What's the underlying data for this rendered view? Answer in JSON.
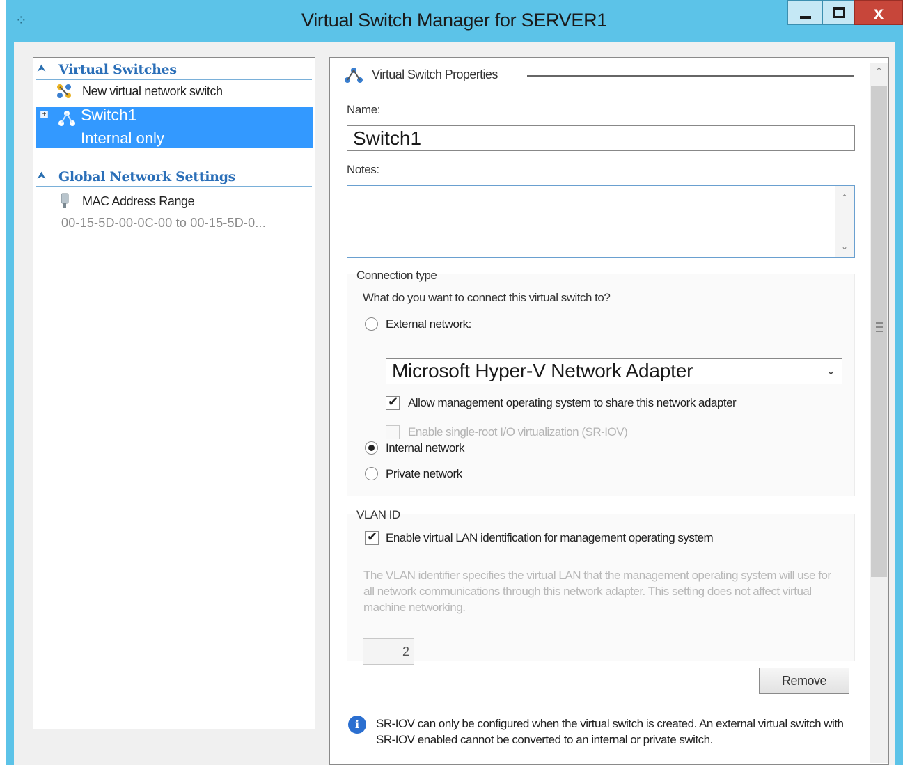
{
  "window": {
    "title": "Virtual Switch Manager for SERVER1",
    "close_symbol": "x",
    "accent_color": "#5cc3e8"
  },
  "left_panel": {
    "virtual_switches_header": "Virtual Switches",
    "new_switch_label": "New virtual network switch",
    "selected_switch": {
      "name": "Switch1",
      "type": "Internal only"
    },
    "global_settings_header": "Global Network Settings",
    "mac_label": "MAC Address Range",
    "mac_value": "00-15-5D-00-0C-00 to 00-15-5D-0..."
  },
  "properties": {
    "header": "Virtual Switch Properties",
    "name_label": "Name:",
    "name_value": "Switch1",
    "notes_label": "Notes:",
    "notes_value": "",
    "connection": {
      "title": "Connection type",
      "question": "What do you want to connect this virtual switch to?",
      "external_label": "External network:",
      "adapter_value": "Microsoft Hyper-V Network Adapter",
      "allow_mgmt_label": "Allow management operating system to share this network adapter",
      "allow_mgmt_checked": true,
      "sriov_label": "Enable single-root I/O virtualization (SR-IOV)",
      "sriov_checked": false,
      "internal_label": "Internal network",
      "private_label": "Private network",
      "selected": "internal"
    },
    "vlan": {
      "title": "VLAN ID",
      "enable_label": "Enable virtual LAN identification for management operating system",
      "enable_checked": true,
      "description": "The VLAN identifier specifies the virtual LAN that the management operating system will use for all network communications through this network adapter. This setting does not affect virtual machine networking.",
      "value": "2"
    },
    "remove_label": "Remove",
    "info_icon": "i",
    "info_text": "SR-IOV can only be configured when the virtual switch is created. An external virtual switch with SR-IOV enabled cannot be converted to an internal or private switch."
  }
}
